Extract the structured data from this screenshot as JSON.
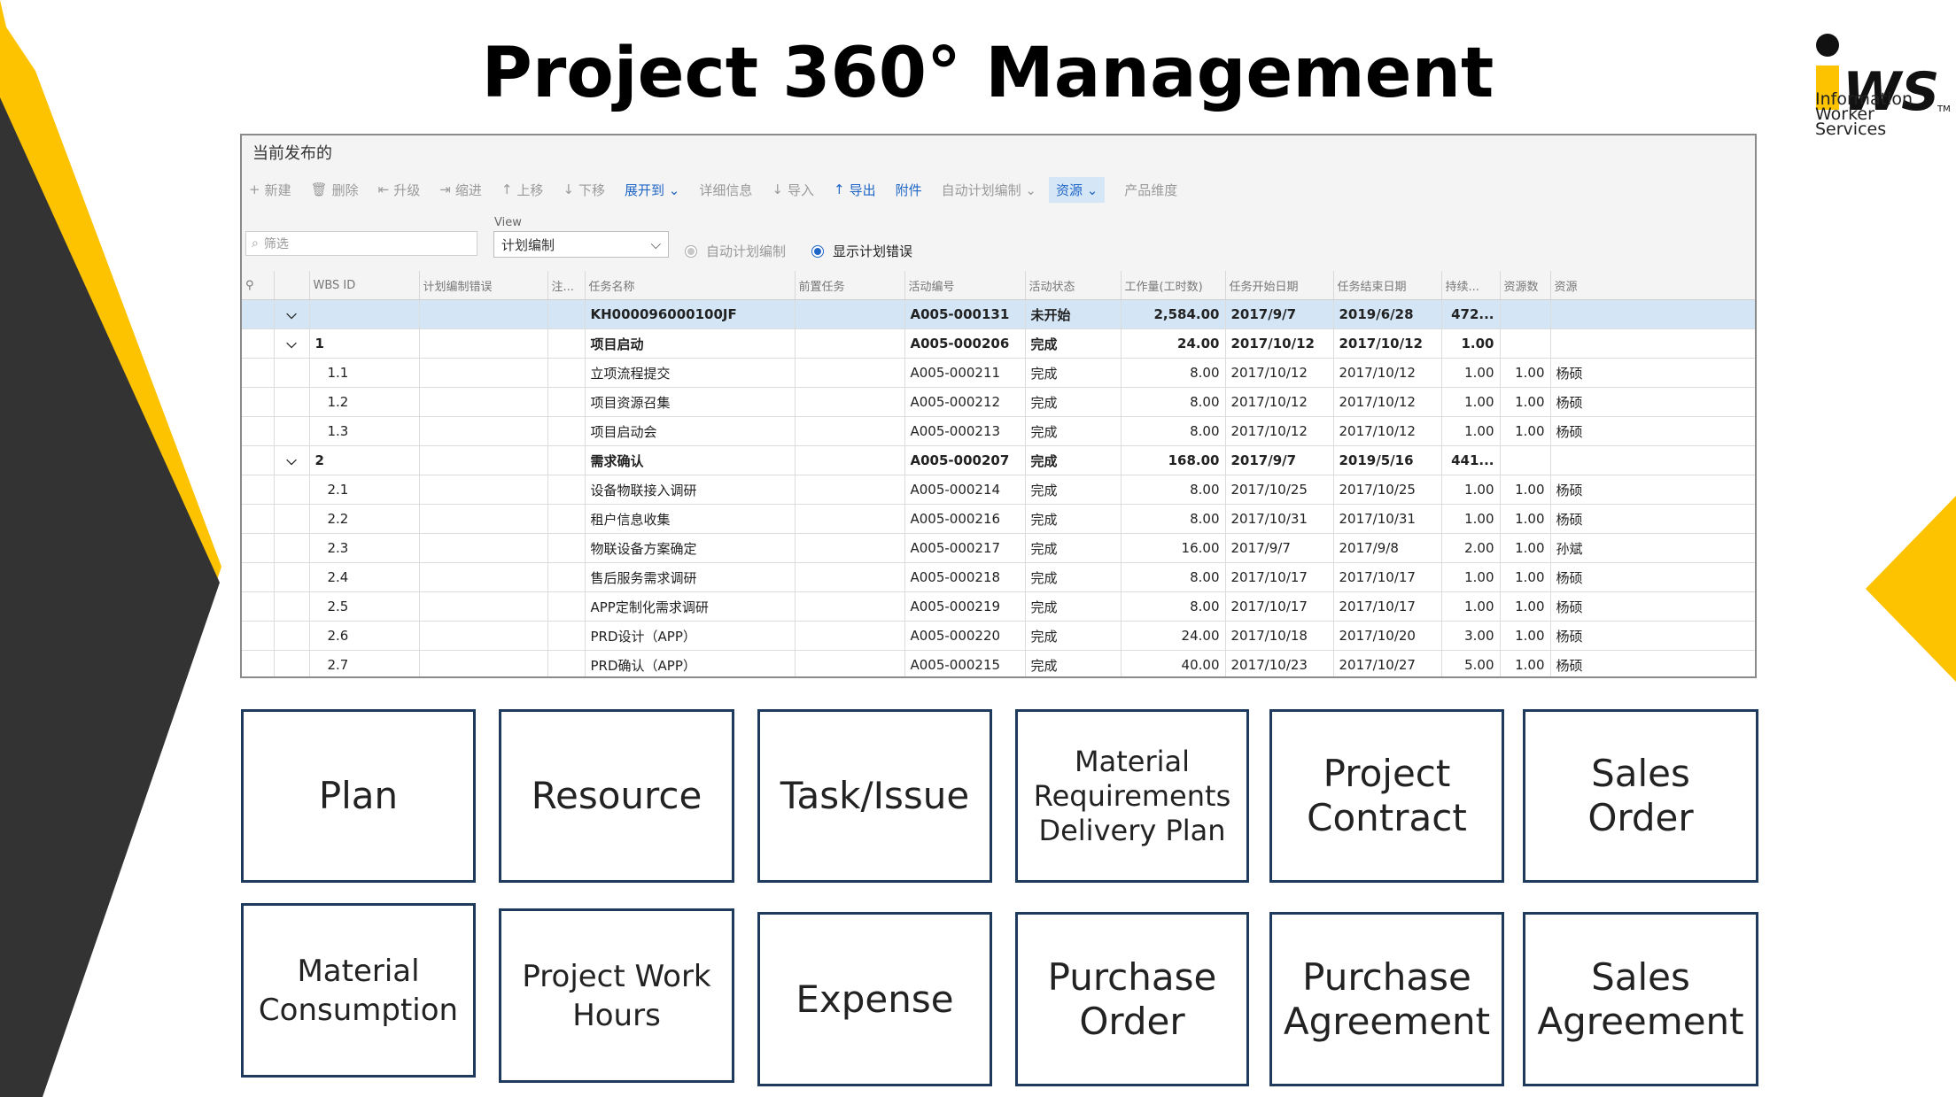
{
  "slide_title": "Project 360° Management",
  "logo": {
    "name": "IWS",
    "lines": [
      "Information",
      "Worker",
      "Services"
    ]
  },
  "app": {
    "title": "当前发布的",
    "toolbar": [
      {
        "icon": "plus-icon",
        "glyph": "+",
        "label": "新建"
      },
      {
        "icon": "trash-icon",
        "glyph": "🗑",
        "label": "删除"
      },
      {
        "icon": "promote-icon",
        "glyph": "⇤",
        "label": "升级"
      },
      {
        "icon": "demote-icon",
        "glyph": "⇥",
        "label": "缩进"
      },
      {
        "icon": "arrow-up-icon",
        "glyph": "↑",
        "label": "上移"
      },
      {
        "icon": "arrow-down-icon",
        "glyph": "↓",
        "label": "下移"
      },
      {
        "icon": "",
        "glyph": "",
        "label": "展开到 ⌄"
      },
      {
        "icon": "",
        "glyph": "",
        "label": "详细信息"
      },
      {
        "icon": "import-icon",
        "glyph": "↓",
        "label": "导入"
      },
      {
        "icon": "export-icon",
        "glyph": "↑",
        "label": "导出"
      },
      {
        "icon": "",
        "glyph": "",
        "label": "附件"
      },
      {
        "icon": "",
        "glyph": "",
        "label": "自动计划编制 ⌄"
      },
      {
        "icon": "",
        "glyph": "",
        "label": "资源 ⌄"
      },
      {
        "icon": "",
        "glyph": "",
        "label": "产品维度"
      }
    ],
    "filter_placeholder": "筛选",
    "view_label": "View",
    "view_value": "计划编制",
    "radio_auto": "自动计划编制",
    "radio_errors": "显示计划错误",
    "columns": [
      "",
      "",
      "WBS ID",
      "计划编制错误",
      "注...",
      "任务名称",
      "前置任务",
      "活动编号",
      "活动状态",
      "工作量(工时数)",
      "任务开始日期",
      "任务结束日期",
      "持续...",
      "资源数",
      "资源"
    ],
    "rows": [
      {
        "exp": "⌵",
        "wbs": "",
        "name": "KH000096000100JF",
        "pre": "",
        "act": "A005-000131",
        "status": "未开始",
        "work": "2,584.00",
        "start": "2017/9/7",
        "end": "2019/6/28",
        "dur": "472...",
        "rescount": "",
        "res": ""
      },
      {
        "exp": "⌵",
        "wbs": "1",
        "name": "项目启动",
        "pre": "",
        "act": "A005-000206",
        "status": "完成",
        "work": "24.00",
        "start": "2017/10/12",
        "end": "2017/10/12",
        "dur": "1.00",
        "rescount": "",
        "res": ""
      },
      {
        "exp": "",
        "wbs": "1.1",
        "name": "立项流程提交",
        "pre": "",
        "act": "A005-000211",
        "status": "完成",
        "work": "8.00",
        "start": "2017/10/12",
        "end": "2017/10/12",
        "dur": "1.00",
        "rescount": "1.00",
        "res": "杨硕"
      },
      {
        "exp": "",
        "wbs": "1.2",
        "name": "项目资源召集",
        "pre": "",
        "act": "A005-000212",
        "status": "完成",
        "work": "8.00",
        "start": "2017/10/12",
        "end": "2017/10/12",
        "dur": "1.00",
        "rescount": "1.00",
        "res": "杨硕"
      },
      {
        "exp": "",
        "wbs": "1.3",
        "name": "项目启动会",
        "pre": "",
        "act": "A005-000213",
        "status": "完成",
        "work": "8.00",
        "start": "2017/10/12",
        "end": "2017/10/12",
        "dur": "1.00",
        "rescount": "1.00",
        "res": "杨硕"
      },
      {
        "exp": "⌵",
        "wbs": "2",
        "name": "需求确认",
        "pre": "",
        "act": "A005-000207",
        "status": "完成",
        "work": "168.00",
        "start": "2017/9/7",
        "end": "2019/5/16",
        "dur": "441...",
        "rescount": "",
        "res": ""
      },
      {
        "exp": "",
        "wbs": "2.1",
        "name": "设备物联接入调研",
        "pre": "",
        "act": "A005-000214",
        "status": "完成",
        "work": "8.00",
        "start": "2017/10/25",
        "end": "2017/10/25",
        "dur": "1.00",
        "rescount": "1.00",
        "res": "杨硕"
      },
      {
        "exp": "",
        "wbs": "2.2",
        "name": "租户信息收集",
        "pre": "",
        "act": "A005-000216",
        "status": "完成",
        "work": "8.00",
        "start": "2017/10/31",
        "end": "2017/10/31",
        "dur": "1.00",
        "rescount": "1.00",
        "res": "杨硕"
      },
      {
        "exp": "",
        "wbs": "2.3",
        "name": "物联设备方案确定",
        "pre": "",
        "act": "A005-000217",
        "status": "完成",
        "work": "16.00",
        "start": "2017/9/7",
        "end": "2017/9/8",
        "dur": "2.00",
        "rescount": "1.00",
        "res": "孙斌"
      },
      {
        "exp": "",
        "wbs": "2.4",
        "name": "售后服务需求调研",
        "pre": "",
        "act": "A005-000218",
        "status": "完成",
        "work": "8.00",
        "start": "2017/10/17",
        "end": "2017/10/17",
        "dur": "1.00",
        "rescount": "1.00",
        "res": "杨硕"
      },
      {
        "exp": "",
        "wbs": "2.5",
        "name": "APP定制化需求调研",
        "pre": "",
        "act": "A005-000219",
        "status": "完成",
        "work": "8.00",
        "start": "2017/10/17",
        "end": "2017/10/17",
        "dur": "1.00",
        "rescount": "1.00",
        "res": "杨硕"
      },
      {
        "exp": "",
        "wbs": "2.6",
        "name": "PRD设计（APP）",
        "pre": "",
        "act": "A005-000220",
        "status": "完成",
        "work": "24.00",
        "start": "2017/10/18",
        "end": "2017/10/20",
        "dur": "3.00",
        "rescount": "1.00",
        "res": "杨硕"
      },
      {
        "exp": "",
        "wbs": "2.7",
        "name": "PRD确认（APP）",
        "pre": "",
        "act": "A005-000215",
        "status": "完成",
        "work": "40.00",
        "start": "2017/10/23",
        "end": "2017/10/27",
        "dur": "5.00",
        "rescount": "1.00",
        "res": "杨硕"
      }
    ]
  },
  "cards_row1": [
    {
      "id": "plan",
      "lines": [
        "Plan"
      ]
    },
    {
      "id": "resource",
      "lines": [
        "Resource"
      ]
    },
    {
      "id": "task-issue",
      "lines": [
        "Task/Issue"
      ]
    },
    {
      "id": "material-requirements",
      "lines": [
        "Material",
        "Requirements",
        "Delivery Plan"
      ]
    },
    {
      "id": "project-contract",
      "lines": [
        "Project",
        "Contract"
      ]
    },
    {
      "id": "sales-order",
      "lines": [
        "Sales",
        "Order"
      ]
    }
  ],
  "cards_row2": [
    {
      "id": "material-consumption",
      "lines": [
        "Material",
        "Consumption"
      ]
    },
    {
      "id": "project-work-hours",
      "lines": [
        "Project Work",
        "Hours"
      ]
    },
    {
      "id": "expense",
      "lines": [
        "Expense"
      ]
    },
    {
      "id": "purchase-order",
      "lines": [
        "Purchase",
        "Order"
      ]
    },
    {
      "id": "purchase-agreement",
      "lines": [
        "Purchase",
        "Agreement"
      ]
    },
    {
      "id": "sales-agreement",
      "lines": [
        "Sales",
        "Agreement"
      ]
    }
  ],
  "colors": {
    "yellow": "#FDC300",
    "dark": "#333333",
    "card_border": "#1e3a5c",
    "selection": "#d4e6f6",
    "accent": "#2066c6"
  }
}
